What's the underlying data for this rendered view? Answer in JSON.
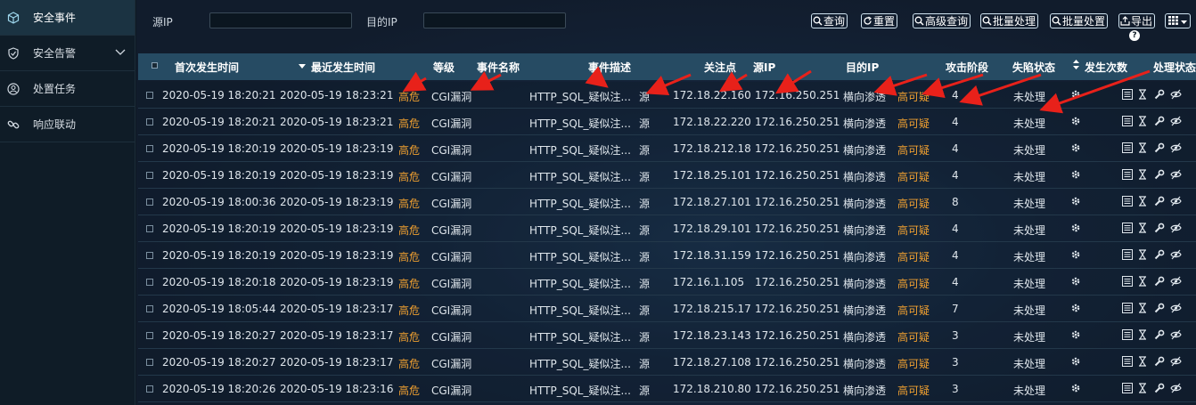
{
  "sidebar": {
    "items": [
      {
        "label": "安全事件",
        "icon": "cube-icon",
        "active": true
      },
      {
        "label": "安全告警",
        "icon": "shield-check-icon",
        "has_submenu": true
      },
      {
        "label": "处置任务",
        "icon": "person-circle-icon"
      },
      {
        "label": "响应联动",
        "icon": "link-icon"
      }
    ]
  },
  "filters": {
    "src_ip_label": "源IP",
    "src_ip_value": "",
    "dst_ip_label": "目的IP",
    "dst_ip_value": ""
  },
  "toolbar": {
    "query": "查询",
    "reset": "重置",
    "advanced": "高级查询",
    "batch_process": "批量处理",
    "batch_dispose": "批量处置",
    "export": "导出",
    "help": "?"
  },
  "table": {
    "columns": [
      "首次发生时间",
      "最近发生时间",
      "等级",
      "事件名称",
      "事件描述",
      "关注点",
      "源IP",
      "目的IP",
      "攻击阶段",
      "失陷状态",
      "发生次数",
      "处理状态"
    ],
    "rows": [
      {
        "first": "2020-05-19 18:20:21",
        "last": "2020-05-19 18:23:21",
        "level": "高危",
        "name": "CGI漏洞",
        "desc": "HTTP_SQL_疑似注...",
        "focus": "源",
        "src": "172.18.22.160",
        "dst": "172.16.250.251",
        "stage": "横向渗透",
        "compromise": "高可疑",
        "count": "4",
        "status": "未处理"
      },
      {
        "first": "2020-05-19 18:20:21",
        "last": "2020-05-19 18:23:21",
        "level": "高危",
        "name": "CGI漏洞",
        "desc": "HTTP_SQL_疑似注...",
        "focus": "源",
        "src": "172.18.22.220",
        "dst": "172.16.250.251",
        "stage": "横向渗透",
        "compromise": "高可疑",
        "count": "4",
        "status": "未处理"
      },
      {
        "first": "2020-05-19 18:20:19",
        "last": "2020-05-19 18:23:19",
        "level": "高危",
        "name": "CGI漏洞",
        "desc": "HTTP_SQL_疑似注...",
        "focus": "源",
        "src": "172.18.212.18",
        "dst": "172.16.250.251",
        "stage": "横向渗透",
        "compromise": "高可疑",
        "count": "4",
        "status": "未处理"
      },
      {
        "first": "2020-05-19 18:20:19",
        "last": "2020-05-19 18:23:19",
        "level": "高危",
        "name": "CGI漏洞",
        "desc": "HTTP_SQL_疑似注...",
        "focus": "源",
        "src": "172.18.25.101",
        "dst": "172.16.250.251",
        "stage": "横向渗透",
        "compromise": "高可疑",
        "count": "4",
        "status": "未处理"
      },
      {
        "first": "2020-05-19 18:00:36",
        "last": "2020-05-19 18:23:19",
        "level": "高危",
        "name": "CGI漏洞",
        "desc": "HTTP_SQL_疑似注...",
        "focus": "源",
        "src": "172.18.27.101",
        "dst": "172.16.250.251",
        "stage": "横向渗透",
        "compromise": "高可疑",
        "count": "8",
        "status": "未处理"
      },
      {
        "first": "2020-05-19 18:20:19",
        "last": "2020-05-19 18:23:19",
        "level": "高危",
        "name": "CGI漏洞",
        "desc": "HTTP_SQL_疑似注...",
        "focus": "源",
        "src": "172.18.29.101",
        "dst": "172.16.250.251",
        "stage": "横向渗透",
        "compromise": "高可疑",
        "count": "4",
        "status": "未处理"
      },
      {
        "first": "2020-05-19 18:20:19",
        "last": "2020-05-19 18:23:19",
        "level": "高危",
        "name": "CGI漏洞",
        "desc": "HTTP_SQL_疑似注...",
        "focus": "源",
        "src": "172.18.31.159",
        "dst": "172.16.250.251",
        "stage": "横向渗透",
        "compromise": "高可疑",
        "count": "4",
        "status": "未处理"
      },
      {
        "first": "2020-05-19 18:20:18",
        "last": "2020-05-19 18:23:19",
        "level": "高危",
        "name": "CGI漏洞",
        "desc": "HTTP_SQL_疑似注...",
        "focus": "源",
        "src": "172.16.1.105",
        "dst": "172.16.250.251",
        "stage": "横向渗透",
        "compromise": "高可疑",
        "count": "4",
        "status": "未处理"
      },
      {
        "first": "2020-05-19 18:05:44",
        "last": "2020-05-19 18:23:17",
        "level": "高危",
        "name": "CGI漏洞",
        "desc": "HTTP_SQL_疑似注...",
        "focus": "源",
        "src": "172.18.215.17",
        "dst": "172.16.250.251",
        "stage": "横向渗透",
        "compromise": "高可疑",
        "count": "7",
        "status": "未处理"
      },
      {
        "first": "2020-05-19 18:20:27",
        "last": "2020-05-19 18:23:17",
        "level": "高危",
        "name": "CGI漏洞",
        "desc": "HTTP_SQL_疑似注...",
        "focus": "源",
        "src": "172.18.23.143",
        "dst": "172.16.250.251",
        "stage": "横向渗透",
        "compromise": "高可疑",
        "count": "3",
        "status": "未处理"
      },
      {
        "first": "2020-05-19 18:20:27",
        "last": "2020-05-19 18:23:17",
        "level": "高危",
        "name": "CGI漏洞",
        "desc": "HTTP_SQL_疑似注...",
        "focus": "源",
        "src": "172.18.27.108",
        "dst": "172.16.250.251",
        "stage": "横向渗透",
        "compromise": "高可疑",
        "count": "3",
        "status": "未处理"
      },
      {
        "first": "2020-05-19 18:20:26",
        "last": "2020-05-19 18:23:16",
        "level": "高危",
        "name": "CGI漏洞",
        "desc": "HTTP_SQL_疑似注...",
        "focus": "源",
        "src": "172.18.210.80",
        "dst": "172.16.250.251",
        "stage": "横向渗透",
        "compromise": "高可疑",
        "count": "3",
        "status": "未处理"
      }
    ],
    "row_icons": [
      "gear-icon",
      "list-icon",
      "hourglass-icon",
      "wrench-icon",
      "eye-off-icon"
    ]
  },
  "colors": {
    "accent_orange": "#f0a030",
    "header_bg": "#264b63",
    "sidebar_active": "#1b3342",
    "annotation_red": "#e8211a"
  }
}
